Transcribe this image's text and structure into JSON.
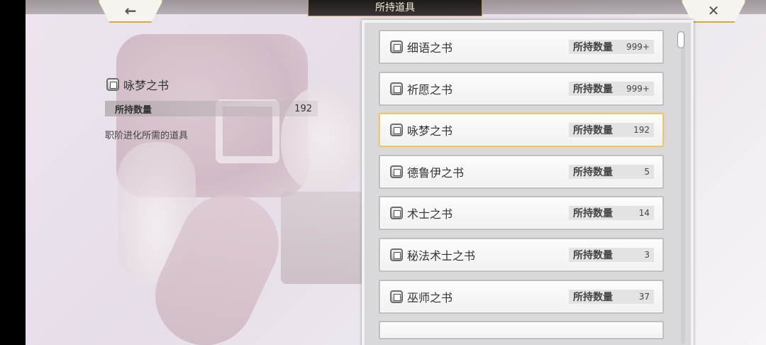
{
  "header": {
    "title": "所持道具",
    "back_icon": "←",
    "close_icon": "✕"
  },
  "detail": {
    "name": "咏梦之书",
    "qty_label": "所持数量",
    "qty_value": "192",
    "description": "职阶进化所需的道具"
  },
  "items": [
    {
      "name": "细语之书",
      "qty_label": "所持数量",
      "qty": "999+"
    },
    {
      "name": "祈愿之书",
      "qty_label": "所持数量",
      "qty": "999+"
    },
    {
      "name": "咏梦之书",
      "qty_label": "所持数量",
      "qty": "192"
    },
    {
      "name": "德鲁伊之书",
      "qty_label": "所持数量",
      "qty": "5"
    },
    {
      "name": "术士之书",
      "qty_label": "所持数量",
      "qty": "14"
    },
    {
      "name": "秘法术士之书",
      "qty_label": "所持数量",
      "qty": "3"
    },
    {
      "name": "巫师之书",
      "qty_label": "所持数量",
      "qty": "37"
    }
  ],
  "colors": {
    "selected_border": "#e3c67a",
    "title_bg": "#1e1b1b",
    "accent_gold": "#c9a95a"
  }
}
